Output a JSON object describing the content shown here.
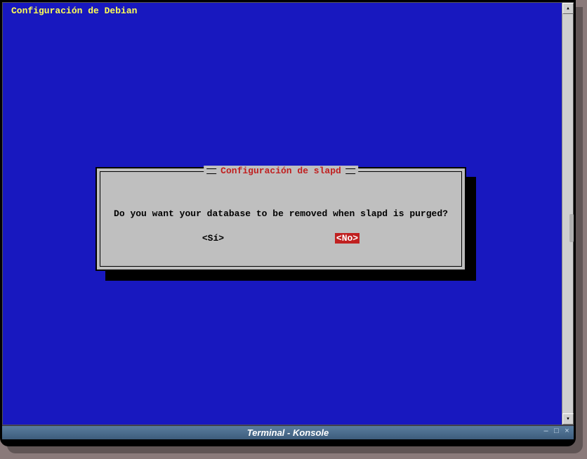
{
  "header": "Configuración de Debian",
  "dialog": {
    "title": "Configuración de slapd",
    "message": "Do you want your database to be removed when slapd is purged?",
    "yes_label": "<Sí>",
    "no_label": "<No>"
  },
  "window": {
    "title": "Terminal - Konsole"
  },
  "scroll": {
    "up": "▴",
    "down": "▾"
  },
  "controls": {
    "minimize": "–",
    "maximize": "□",
    "close": "×"
  }
}
